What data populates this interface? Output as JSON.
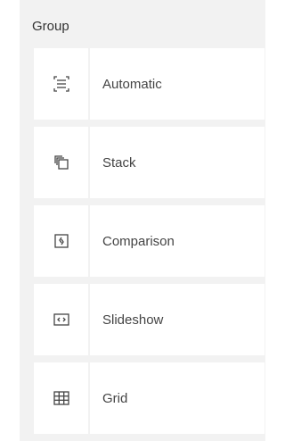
{
  "group": {
    "title": "Group",
    "options": [
      {
        "label": "Automatic",
        "icon": "automatic-layout-icon"
      },
      {
        "label": "Stack",
        "icon": "stack-icon"
      },
      {
        "label": "Comparison",
        "icon": "comparison-icon"
      },
      {
        "label": "Slideshow",
        "icon": "slideshow-icon"
      },
      {
        "label": "Grid",
        "icon": "grid-icon"
      }
    ]
  },
  "colors": {
    "panel_background": "#f2f2f2",
    "tile_background": "#ffffff",
    "text": "#444444",
    "icon": "#444444"
  }
}
